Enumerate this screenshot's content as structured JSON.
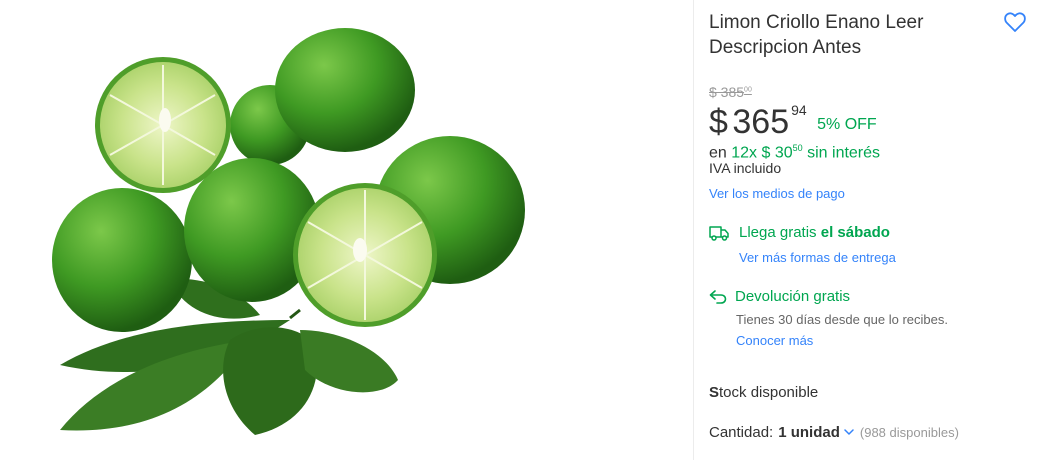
{
  "product": {
    "title": "Limon Criollo Enano Leer Descripcion Antes",
    "image_alt": "lime-photo"
  },
  "price": {
    "old_price": "$ 385",
    "old_cents": "00",
    "currency": "$",
    "amount": "365",
    "cents": "94",
    "discount": "5% OFF"
  },
  "installments": {
    "prefix": "en",
    "text": "12x $ 30",
    "cents": "50",
    "suffix": "sin interés"
  },
  "tax_note": "IVA incluido",
  "payment_link": "Ver los medios de pago",
  "shipping": {
    "text": "Llega gratis",
    "day": "el sábado",
    "more_link": "Ver más formas de entrega"
  },
  "returns": {
    "title": "Devolución gratis",
    "detail": "Tienes 30 días desde que lo recibes.",
    "link": "Conocer más"
  },
  "stock": {
    "bold": "S",
    "rest": "tock disponible"
  },
  "quantity": {
    "label": "Cantidad:",
    "value": "1 unidad",
    "available": "(988 disponibles)"
  },
  "colors": {
    "accent": "#3483fa",
    "green": "#00a650",
    "text": "#333333",
    "muted": "#999999"
  },
  "icons": {
    "favorite": "heart-icon",
    "shipping": "truck-icon",
    "returns": "return-arrow-icon",
    "dropdown": "chevron-down-icon"
  }
}
